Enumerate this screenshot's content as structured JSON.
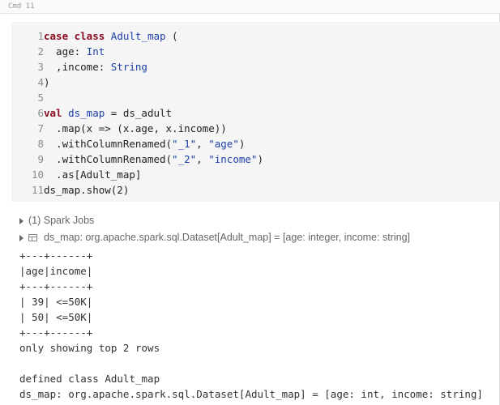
{
  "cell": {
    "label": "Cmd 11"
  },
  "code": [
    {
      "n": "1",
      "parts": [
        [
          "kw",
          "case class "
        ],
        [
          "ty",
          "Adult_map"
        ],
        [
          "op",
          " ("
        ]
      ]
    },
    {
      "n": "2",
      "parts": [
        [
          "op",
          "  age: "
        ],
        [
          "ty",
          "Int"
        ]
      ]
    },
    {
      "n": "3",
      "parts": [
        [
          "op",
          "  ,income: "
        ],
        [
          "ty",
          "String"
        ]
      ]
    },
    {
      "n": "4",
      "parts": [
        [
          "op",
          ")"
        ]
      ]
    },
    {
      "n": "5",
      "parts": []
    },
    {
      "n": "6",
      "parts": [
        [
          "kw",
          "val "
        ],
        [
          "ty",
          "ds_map"
        ],
        [
          "op",
          " = ds_adult"
        ]
      ]
    },
    {
      "n": "7",
      "parts": [
        [
          "op",
          "  .map(x => (x.age, x.income))"
        ]
      ]
    },
    {
      "n": "8",
      "parts": [
        [
          "op",
          "  .withColumnRenamed("
        ],
        [
          "st",
          "\"_1\""
        ],
        [
          "op",
          ", "
        ],
        [
          "st",
          "\"age\""
        ],
        [
          "op",
          ")"
        ]
      ]
    },
    {
      "n": "9",
      "parts": [
        [
          "op",
          "  .withColumnRenamed("
        ],
        [
          "st",
          "\"_2\""
        ],
        [
          "op",
          ", "
        ],
        [
          "st",
          "\"income\""
        ],
        [
          "op",
          ")"
        ]
      ]
    },
    {
      "n": "10",
      "parts": [
        [
          "op",
          "  .as[Adult_map]"
        ]
      ]
    },
    {
      "n": "11",
      "parts": [
        [
          "op",
          "ds_map.show(2)"
        ]
      ]
    }
  ],
  "output": {
    "spark_jobs": "(1) Spark Jobs",
    "dataset": "ds_map:  org.apache.spark.sql.Dataset[Adult_map] = [age: integer, income: string]"
  },
  "stdout": [
    "+---+------+",
    "|age|income|",
    "+---+------+",
    "| 39| <=50K|",
    "| 50| <=50K|",
    "+---+------+",
    "only showing top 2 rows",
    "",
    "defined class Adult_map",
    "ds_map: org.apache.spark.sql.Dataset[Adult_map] = [age: int, income: string]"
  ]
}
